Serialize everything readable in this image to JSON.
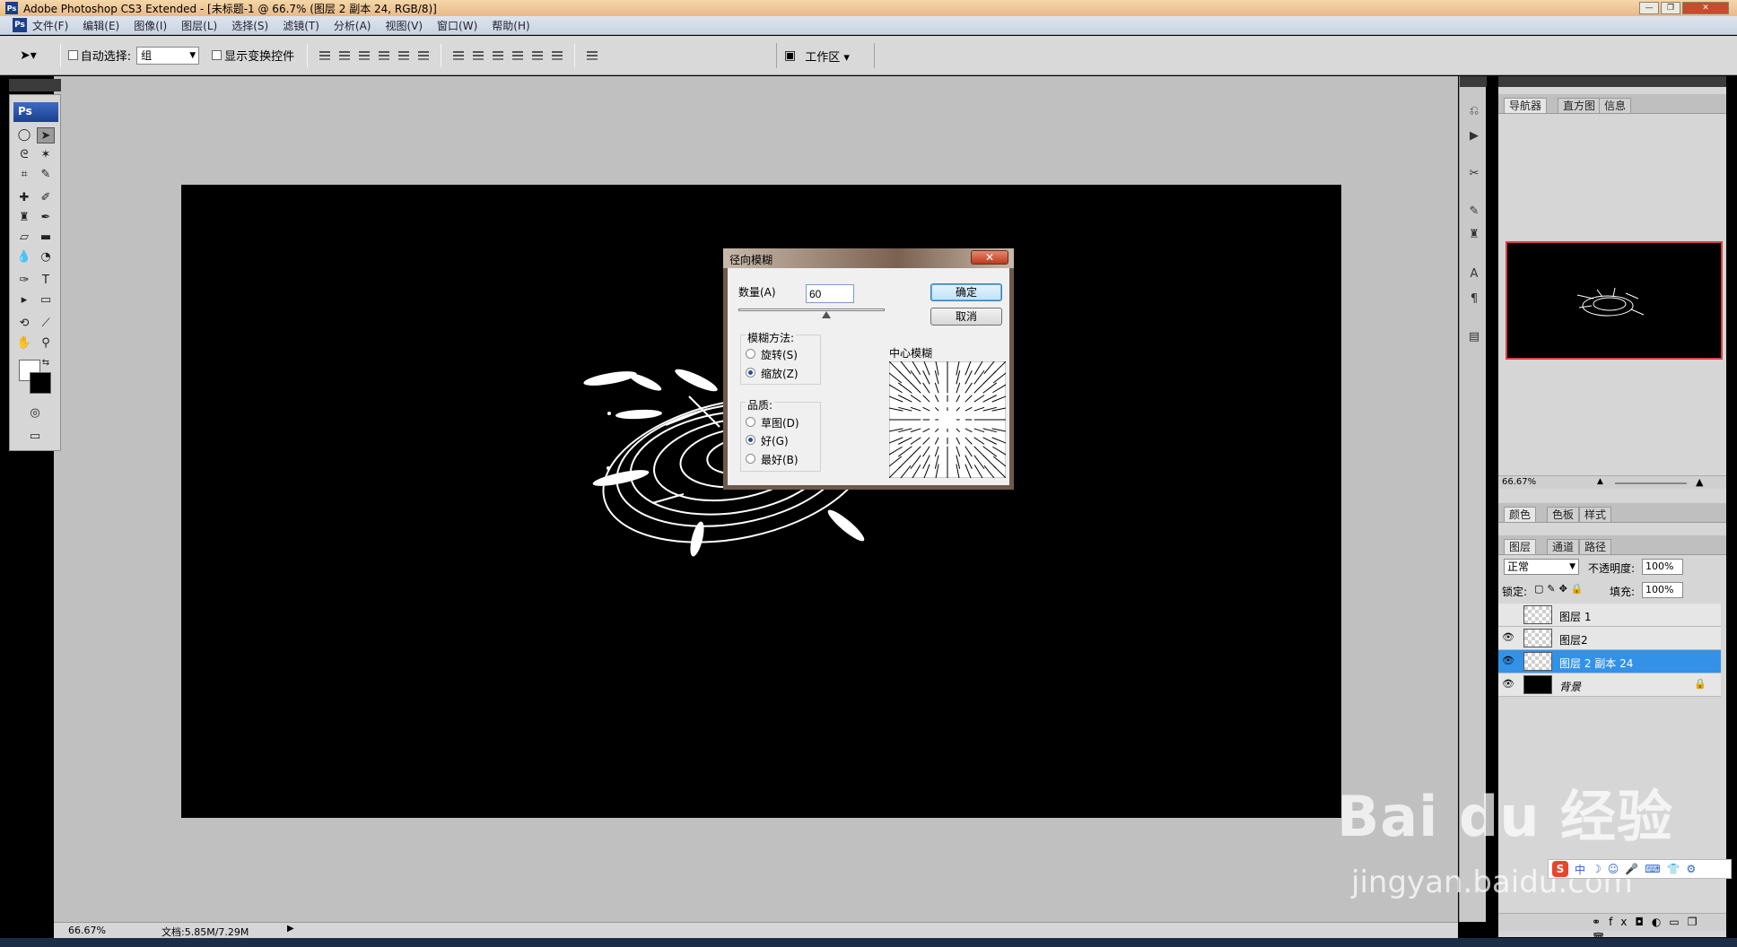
{
  "window": {
    "title": "Adobe Photoshop CS3 Extended - [未标题-1 @ 66.7% (图层 2 副本 24, RGB/8)]",
    "app_icon": "Ps"
  },
  "menu": [
    "文件(F)",
    "编辑(E)",
    "图像(I)",
    "图层(L)",
    "选择(S)",
    "滤镜(T)",
    "分析(A)",
    "视图(V)",
    "窗口(W)",
    "帮助(H)"
  ],
  "options": {
    "auto_select_label": "自动选择:",
    "auto_select_value": "组",
    "show_transform_label": "显示变换控件",
    "workspace_label": "工作区 ▾"
  },
  "toolbox": {
    "logo": "Ps"
  },
  "dialog": {
    "title": "径向模糊",
    "amount_label": "数量(A)",
    "amount_value": "60",
    "amount_fraction": 0.6,
    "ok_label": "确定",
    "cancel_label": "取消",
    "method_label": "模糊方法:",
    "method_options": [
      "旋转(S)",
      "缩放(Z)"
    ],
    "method_selected": 1,
    "quality_label": "品质:",
    "quality_options": [
      "草图(D)",
      "好(G)",
      "最好(B)"
    ],
    "quality_selected": 1,
    "center_label": "中心模糊"
  },
  "panels": {
    "nav_tabs": [
      "导航器",
      "直方图",
      "信息"
    ],
    "nav_zoom": "66.67%",
    "color_tabs": [
      "颜色",
      "色板",
      "样式"
    ],
    "layer_tabs": [
      "图层",
      "通道",
      "路径"
    ],
    "blend_mode": "正常",
    "opacity_label": "不透明度:",
    "opacity_value": "100%",
    "lock_label": "锁定:",
    "fill_label": "填充:",
    "fill_value": "100%",
    "layers": [
      {
        "name": "图层 1",
        "visible": false,
        "selected": false
      },
      {
        "name": "图层2",
        "visible": true,
        "selected": false
      },
      {
        "name": "图层 2 副本 24",
        "visible": true,
        "selected": true
      },
      {
        "name": "背景",
        "visible": true,
        "selected": false,
        "locked": true
      }
    ]
  },
  "status": {
    "zoom": "66.67%",
    "doc_info": "文档:5.85M/7.29M"
  },
  "watermark": {
    "main": "Bai du 经验",
    "sub": "jingyan.baidu.com"
  },
  "ime": {
    "logo": "S",
    "mode": "中"
  },
  "colors": {
    "selection": "#3392e8",
    "dialog_default": "#3c7fb1"
  }
}
